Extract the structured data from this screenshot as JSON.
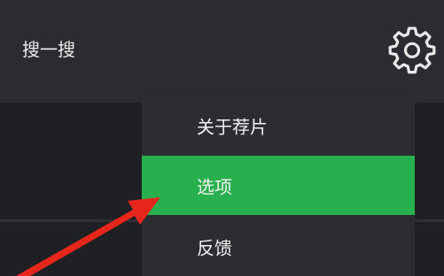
{
  "header": {
    "search_label": "搜一搜",
    "settings_icon": "gear-icon"
  },
  "menu": {
    "items": [
      {
        "label": "关于荐片"
      },
      {
        "label": "选项",
        "selected": true
      },
      {
        "label": "反馈"
      }
    ],
    "highlight_color": "#27b04d"
  },
  "annotation": {
    "arrow_color": "#e8271c",
    "arrow_target": "menu-item-options"
  }
}
